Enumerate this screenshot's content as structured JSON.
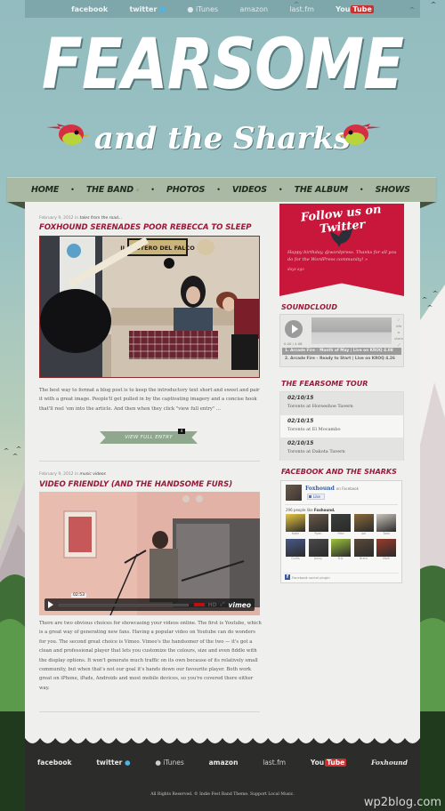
{
  "colors": {
    "accent": "#9a1a3a",
    "twitter_red": "#c8173a",
    "nav_bg": "#a9b9a3",
    "footer_bg": "#2c2c2b",
    "sky": "#93bcc0",
    "button_green": "#8fa88d"
  },
  "top_social": [
    {
      "label": "facebook",
      "icon": "facebook-logo"
    },
    {
      "label": "twitter",
      "icon": "twitter-bird-icon"
    },
    {
      "label": "iTunes",
      "icon": "apple-icon"
    },
    {
      "label": "amazon",
      "icon": "amazon-logo"
    },
    {
      "label": "last.fm",
      "icon": "lastfm-logo"
    },
    {
      "label": "You",
      "label2": "Tube",
      "icon": "youtube-logo"
    }
  ],
  "header": {
    "title": "FEARSOME",
    "subtitle": "and the Sharks"
  },
  "nav": {
    "items": [
      "HOME",
      "THE BAND",
      "PHOTOS",
      "VIDEOS",
      "THE ALBUM",
      "SHOWS"
    ],
    "dropdown_caret": "▾"
  },
  "posts": [
    {
      "date": "February 9, 2012 in",
      "category": "tales from the road...",
      "title": "FOXHOUND SERENADES POOR REBECCA TO SLEEP",
      "image_alt": "Band members on a couch with guitar; poster reads IL MISTERO DEL FALCO",
      "poster_text": "IL MISTERO DEL FALCO",
      "excerpt": "The best way to format a blog post is to keep the introductory text short and sweet and pair it with a great image. People'll get pulled in by the captivating imagery and a concise hook that'll reel 'em into the article. And then when they click \"view full entry\" ...",
      "more_label": "VIEW FULL ENTRY",
      "comment_count": "4"
    },
    {
      "date": "February 9, 2012 in",
      "category": "music videos",
      "title": "VIDEO FRIENDLY (AND THE HANDSOME FURS)",
      "video": {
        "time": "02:53",
        "hd_label": "HD",
        "provider": "vimeo"
      },
      "excerpt": "There are two obvious choices for showcasing your videos online. The first is Youtube, which is a great way of generating new fans. Having a popular video on Youtube can do wonders for you. The second great choice is Vimeo. Vimeo's the handsomer of the two — it's got a clean and professional player that lets you customize the colours, size and even fiddle with the display options. It won't generate much traffic on its own because of its relatively small community, but when that's not our goal it's hands down our favourite player. Both work great on iPhone, iPads, Androids and most mobile devices, so you're covered there either way."
    }
  ],
  "sidebar": {
    "twitter": {
      "title": "Follow us on Twitter",
      "tweet": "Happy birthday, @wordpress. Thanks for all you do for the WordPress community! »",
      "age": "days ago"
    },
    "soundcloud": {
      "heading": "SOUNDCLOUD",
      "time": "0.00 / 4.08",
      "icons": [
        "♪",
        "info",
        "≡",
        "share",
        "⤢"
      ],
      "tracks": [
        {
          "label": "1. Arcade Fire – Month of May | Live on KROQ",
          "duration": "4.08"
        },
        {
          "label": "2. Arcade Fire – Ready to Start | Live on KROQ",
          "duration": "4.26"
        }
      ]
    },
    "tour": {
      "heading": "THE FEARSOME TOUR",
      "shows": [
        {
          "date": "02/10/15",
          "venue": "Toronto at Horseshoe Tavern"
        },
        {
          "date": "02/10/15",
          "venue": "Toronto at El Mocambo"
        },
        {
          "date": "02/10/15",
          "venue": "Toronto at Dakota Tavern"
        }
      ]
    },
    "facebook": {
      "heading": "FACEBOOK AND THE SHARKS",
      "page_name": "Foxhound",
      "on_facebook": "on Facebook",
      "like_label": "Like",
      "count_text": "296 people like",
      "count_name": "Foxhound.",
      "fans": [
        {
          "name": "Katie",
          "color": "#e8c640"
        },
        {
          "name": "Ryan",
          "color": "#6b5a4a"
        },
        {
          "name": "Pete",
          "color": "#3a3f3a"
        },
        {
          "name": "Joe",
          "color": "#8a6a3a"
        },
        {
          "name": "Todd",
          "color": "#c9c4bc"
        },
        {
          "name": "Curtis",
          "color": "#4a5a8a"
        },
        {
          "name": "Jenny",
          "color": "#4a4a4a"
        },
        {
          "name": "R.G.",
          "color": "#9ac23a"
        },
        {
          "name": "Brent",
          "color": "#5a4a3a"
        },
        {
          "name": "Mark",
          "color": "#9a3a2a"
        }
      ],
      "footer": "Facebook social plugin"
    }
  },
  "footer": {
    "links": [
      {
        "label": "facebook",
        "icon": "facebook-logo"
      },
      {
        "label": "twitter",
        "icon": "twitter-bird-icon"
      },
      {
        "label": "iTunes",
        "icon": "apple-icon"
      },
      {
        "label": "amazon",
        "icon": "amazon-logo"
      },
      {
        "label": "last.fm",
        "icon": "lastfm-logo"
      },
      {
        "label": "You",
        "label2": "Tube",
        "icon": "youtube-logo"
      },
      {
        "label": "Foxhound",
        "icon": "foxhound-logo"
      }
    ],
    "copyright": "All Rights Reserved. © Indie Fest Band Theme. Support Local Music.",
    "watermark": "wp2blog.com"
  }
}
